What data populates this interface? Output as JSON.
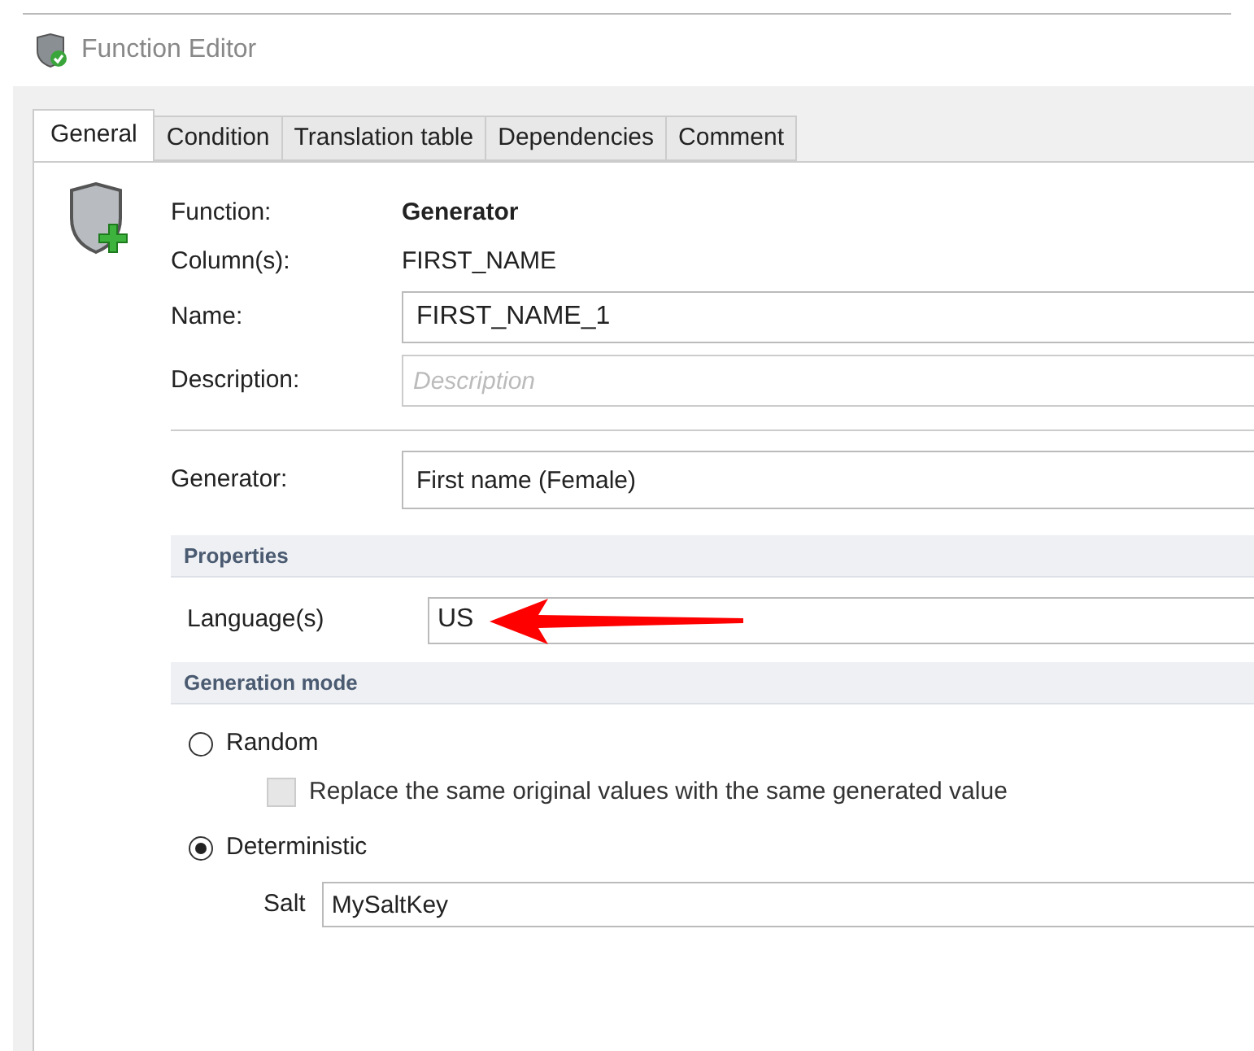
{
  "window": {
    "title": "Function Editor"
  },
  "tabs": [
    {
      "label": "General",
      "selected": true
    },
    {
      "label": "Condition",
      "selected": false
    },
    {
      "label": "Translation table",
      "selected": false
    },
    {
      "label": "Dependencies",
      "selected": false
    },
    {
      "label": "Comment",
      "selected": false
    }
  ],
  "info": [
    {
      "label": "Function:",
      "value": "Generator",
      "bold": true
    },
    {
      "label": "Column(s):",
      "value": "FIRST_NAME",
      "bold": false
    }
  ],
  "name_field": {
    "label": "Name:",
    "value": "FIRST_NAME_1"
  },
  "description_field": {
    "label": "Description:",
    "placeholder": "Description"
  },
  "generator_field": {
    "label": "Generator:",
    "value": "First name (Female)"
  },
  "properties": {
    "title": "Properties",
    "language_label": "Language(s)",
    "language_value": "US"
  },
  "generation_mode": {
    "title": "Generation mode",
    "options": [
      {
        "label": "Random",
        "selected": false
      },
      {
        "label": "Deterministic",
        "selected": true
      }
    ],
    "replace_checkbox": {
      "label": "Replace the same original values with the same generated value",
      "checked": false,
      "disabled": true
    },
    "salt_label": "Salt",
    "salt_value": "MySaltKey"
  }
}
